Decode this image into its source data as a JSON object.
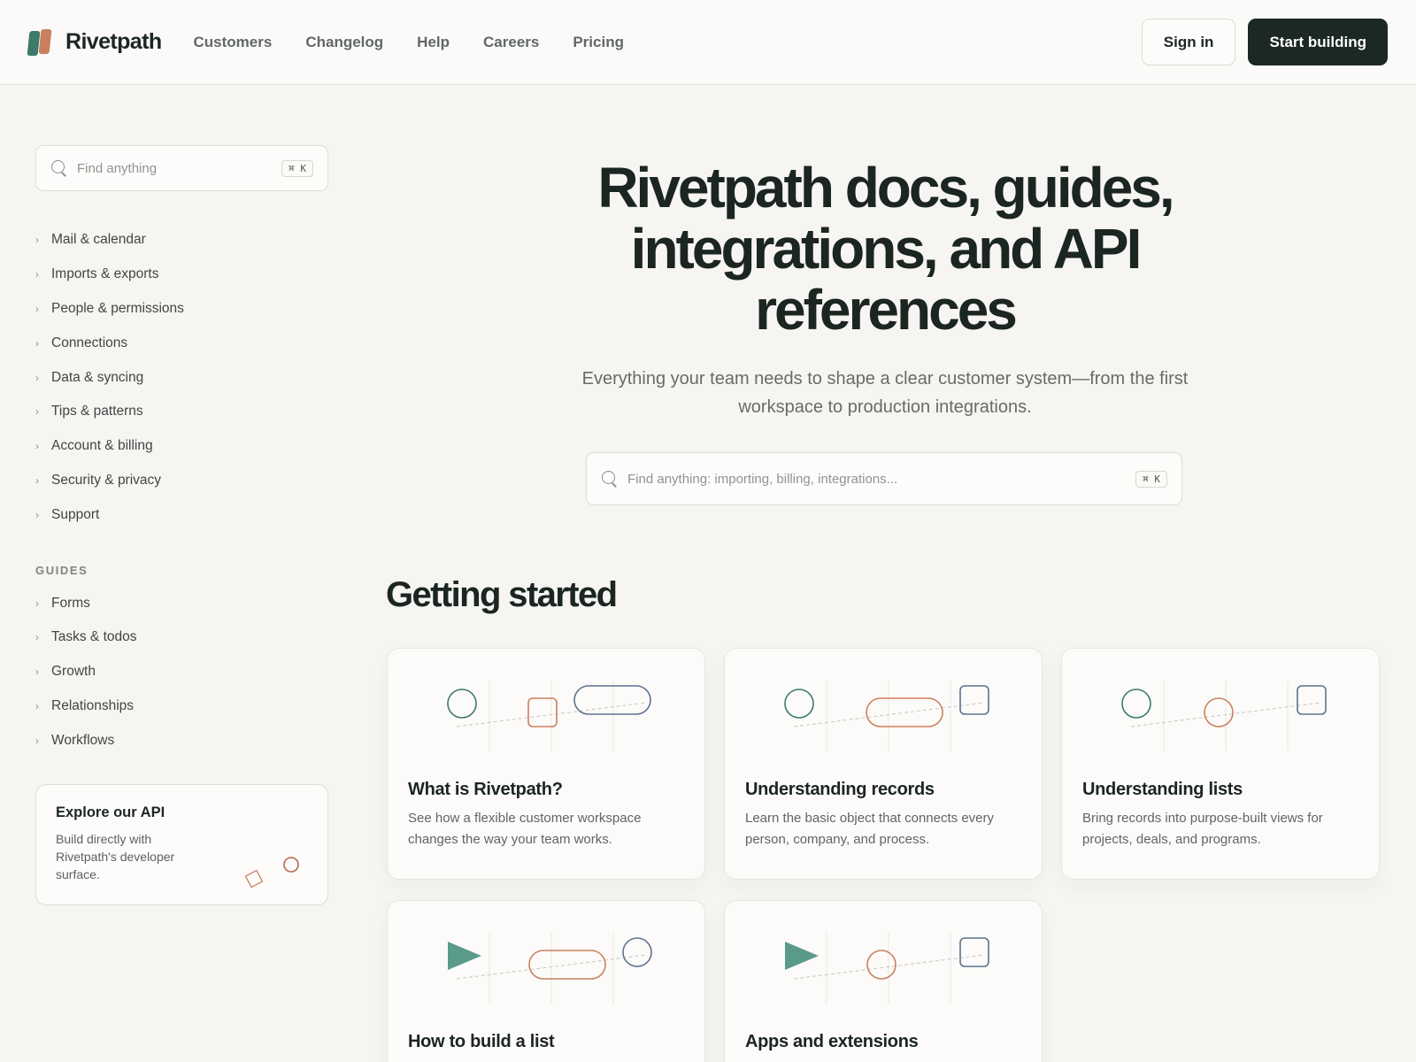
{
  "brand": {
    "name": "Rivetpath"
  },
  "nav": {
    "links": [
      "Customers",
      "Changelog",
      "Help",
      "Careers",
      "Pricing"
    ],
    "signin_label": "Sign in",
    "start_label": "Start building"
  },
  "sidebar": {
    "search_placeholder": "Find anything",
    "shortcut": "⌘ K",
    "items": [
      "Mail & calendar",
      "Imports & exports",
      "People & permissions",
      "Connections",
      "Data & syncing",
      "Tips & patterns",
      "Account & billing",
      "Security & privacy",
      "Support"
    ],
    "guides_heading": "GUIDES",
    "guides": [
      "Forms",
      "Tasks & todos",
      "Growth",
      "Relationships",
      "Workflows"
    ],
    "api_card": {
      "title": "Explore our API",
      "description": "Build directly with Rivetpath's developer surface."
    }
  },
  "hero": {
    "title": "Rivetpath docs, guides, integrations, and API references",
    "subtitle": "Everything your team needs to shape a clear customer system—from the first workspace to production integrations.",
    "search_placeholder": "Find anything: importing, billing, integrations...",
    "shortcut": "⌘ K"
  },
  "getting_started": {
    "heading": "Getting started",
    "cards": [
      {
        "title": "What is Rivetpath?",
        "description": "See how a flexible customer workspace changes the way your team works."
      },
      {
        "title": "Understanding records",
        "description": "Learn the basic object that connects every person, company, and process."
      },
      {
        "title": "Understanding lists",
        "description": "Bring records into purpose-built views for projects, deals, and programs."
      },
      {
        "title": "How to build a list",
        "description": ""
      },
      {
        "title": "Apps and extensions",
        "description": ""
      }
    ]
  },
  "colors": {
    "teal": "#3c7a6a",
    "clay": "#c9805e",
    "slate": "#5b7291",
    "dark": "#1b2826",
    "background": "#f6f5f2"
  }
}
